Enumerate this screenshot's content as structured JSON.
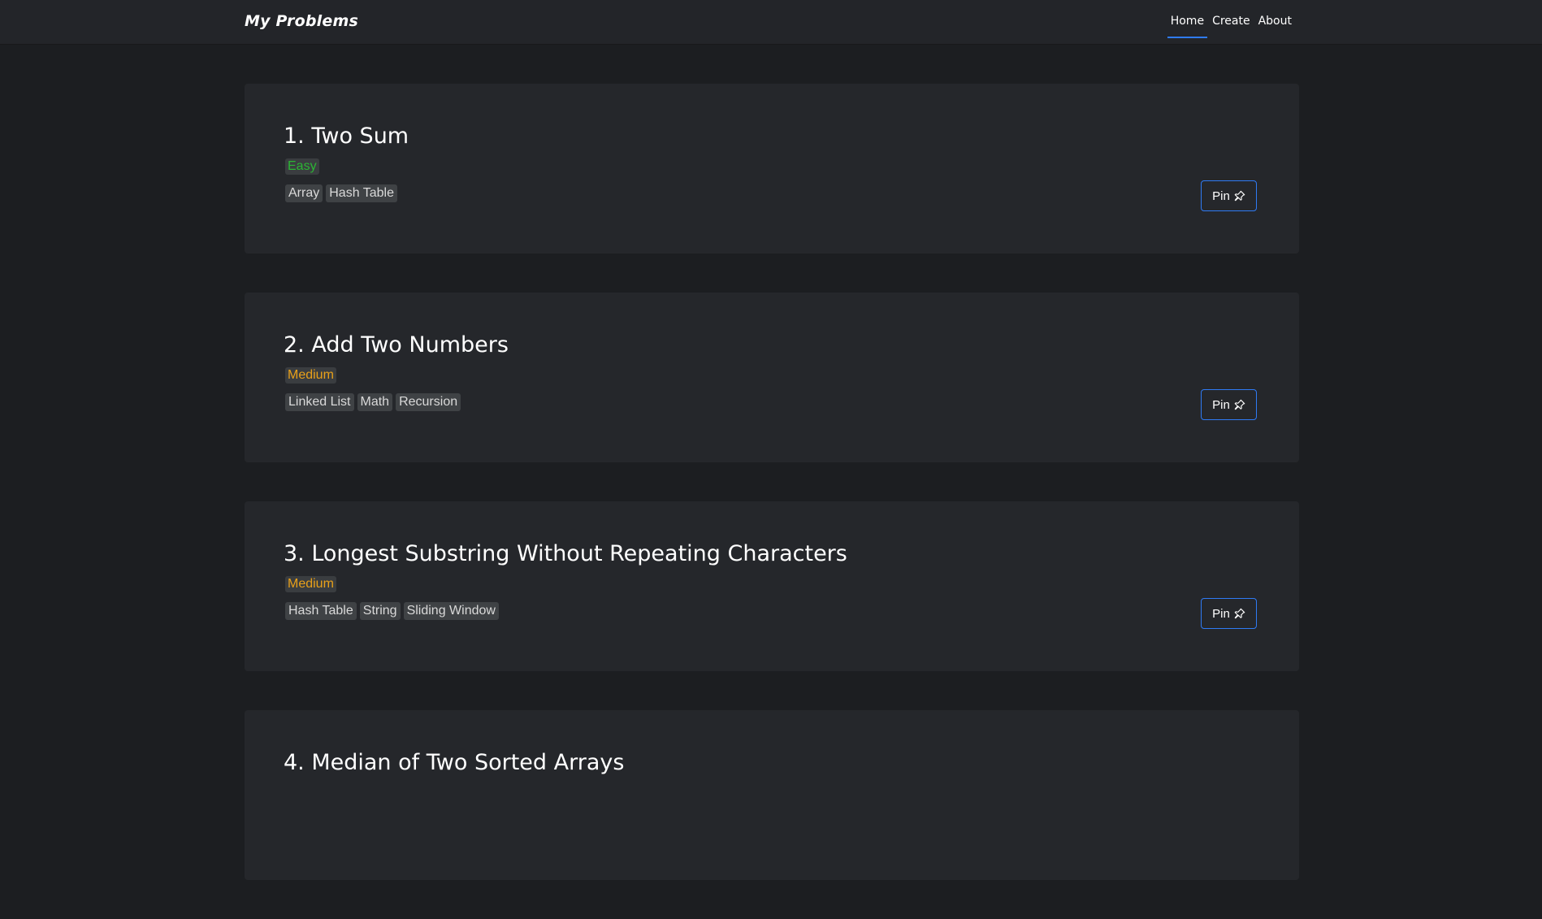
{
  "nav": {
    "brand": "My Problems",
    "links": [
      {
        "label": "Home",
        "active": true
      },
      {
        "label": "Create",
        "active": false
      },
      {
        "label": "About",
        "active": false
      }
    ],
    "accent_color": "#2f7bf5"
  },
  "problems": [
    {
      "title": "1. Two Sum",
      "difficulty": "Easy",
      "tags": [
        "Array",
        "Hash Table"
      ],
      "pin_label": "Pin"
    },
    {
      "title": "2. Add Two Numbers",
      "difficulty": "Medium",
      "tags": [
        "Linked List",
        "Math",
        "Recursion"
      ],
      "pin_label": "Pin"
    },
    {
      "title": "3. Longest Substring Without Repeating Characters",
      "difficulty": "Medium",
      "tags": [
        "Hash Table",
        "String",
        "Sliding Window"
      ],
      "pin_label": "Pin"
    },
    {
      "title": "4. Median of Two Sorted Arrays",
      "difficulty": "",
      "tags": [],
      "pin_label": ""
    }
  ],
  "colors": {
    "easy": "#2bb534",
    "medium": "#e8a019"
  },
  "icons": {
    "pin": "pin-icon"
  }
}
